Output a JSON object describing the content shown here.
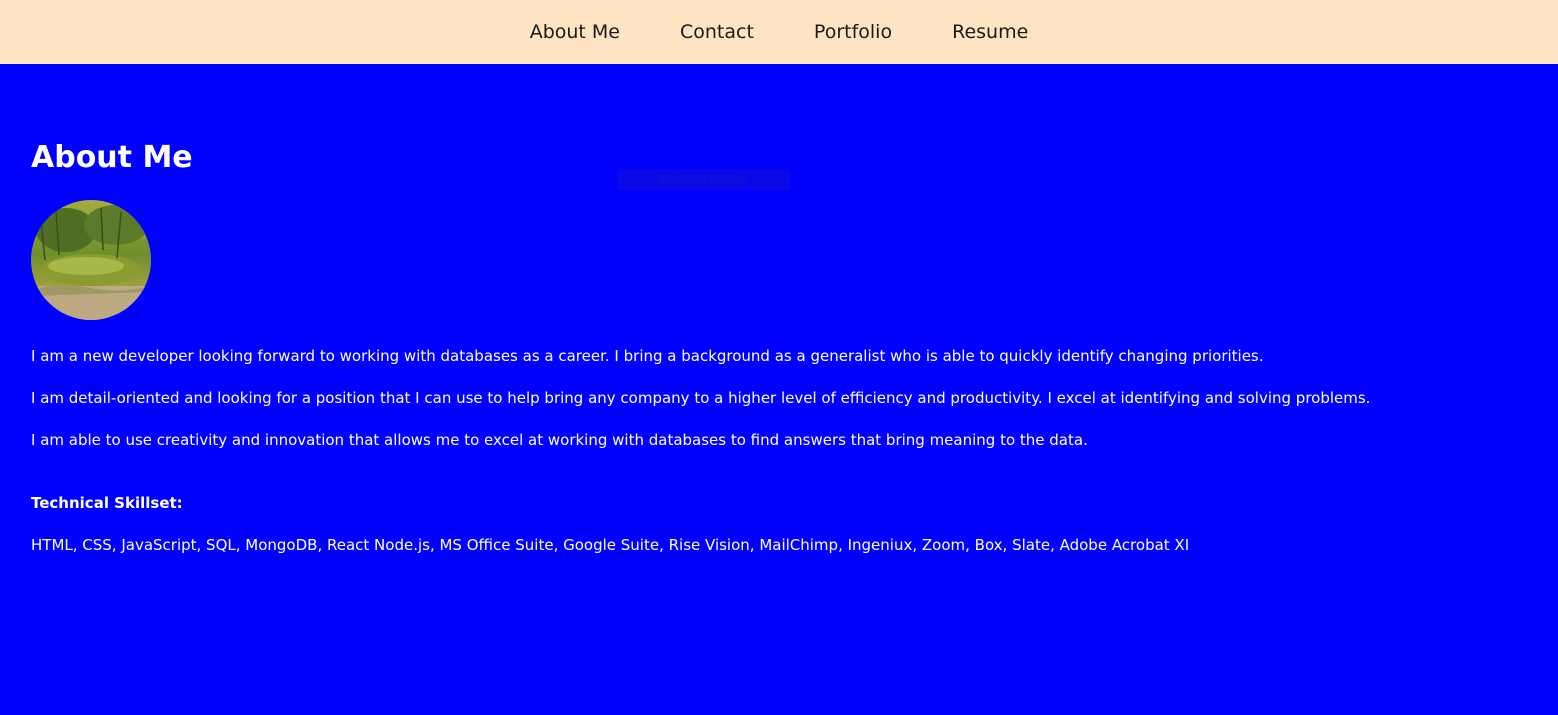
{
  "nav": {
    "items": [
      {
        "label": "About Me"
      },
      {
        "label": "Contact"
      },
      {
        "label": "Portfolio"
      },
      {
        "label": "Resume"
      }
    ]
  },
  "about": {
    "title": "About Me",
    "avatar_icon": "profile-photo-moss-landscape",
    "paragraphs": [
      "I am a new developer looking forward to working with databases as a career. I bring a background as a generalist who is able to quickly identify changing priorities.",
      "I am detail-oriented and looking for a position that I can use to help bring any company to a higher level of efficiency and productivity. I excel at identifying and solving problems.",
      "I am able to use creativity and innovation that allows me to excel at working with databases to find answers that bring meaning to the data."
    ],
    "skills_heading": "Technical Skillset:",
    "skills_list": "HTML, CSS, JavaScript, SQL, MongoDB, React Node.js, MS Office Suite, Google Suite, Rise Vision, MailChimp, Ingeniux, Zoom, Box, Slate, Adobe Acrobat XI"
  },
  "overlay_button": {
    "label": "Portfolio Button"
  },
  "colors": {
    "nav_background": "#FFE4C4",
    "page_background": "#0000FF",
    "text": "#FFFFFF"
  }
}
